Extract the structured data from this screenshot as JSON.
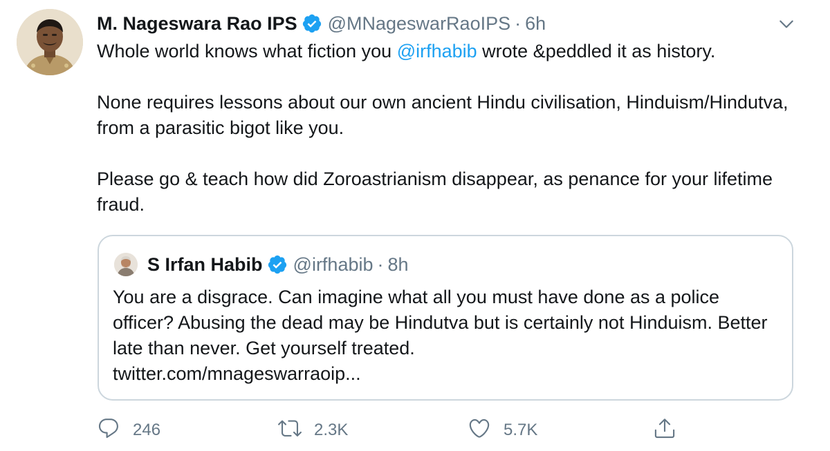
{
  "tweet": {
    "author_name": "M. Nageswara Rao IPS",
    "handle": "@MNageswarRaoIPS",
    "separator": "·",
    "time": "6h",
    "body": {
      "line1_pre": "Whole world knows what fiction you ",
      "line1_mention": "@irfhabib",
      "line1_post": " wrote &peddled it as history.",
      "para2": "None requires lessons about our own ancient Hindu civilisation, Hinduism/Hindutva, from a parasitic bigot like you.",
      "para3": "Please go & teach how did Zoroastrianism disappear, as penance for your lifetime fraud."
    }
  },
  "quoted_tweet": {
    "author_name": "S Irfan Habib",
    "handle": "@irfhabib",
    "separator": "·",
    "time": "8h",
    "body": "You are a disgrace. Can imagine what all you must have done as a police officer? Abusing the dead may be Hindutva but is certainly not Hinduism. Better late than never. Get yourself treated.",
    "link": "twitter.com/mnageswarraoip..."
  },
  "actions": {
    "replies": "246",
    "retweets": "2.3K",
    "likes": "5.7K"
  },
  "icons": {
    "verified": "verified-badge-icon",
    "caret": "chevron-down-icon",
    "reply": "reply-icon",
    "retweet": "retweet-icon",
    "like": "heart-icon",
    "share": "share-icon"
  },
  "colors": {
    "accent": "#1da1f2",
    "secondary_text": "#657786",
    "border": "#ccd6dd"
  }
}
